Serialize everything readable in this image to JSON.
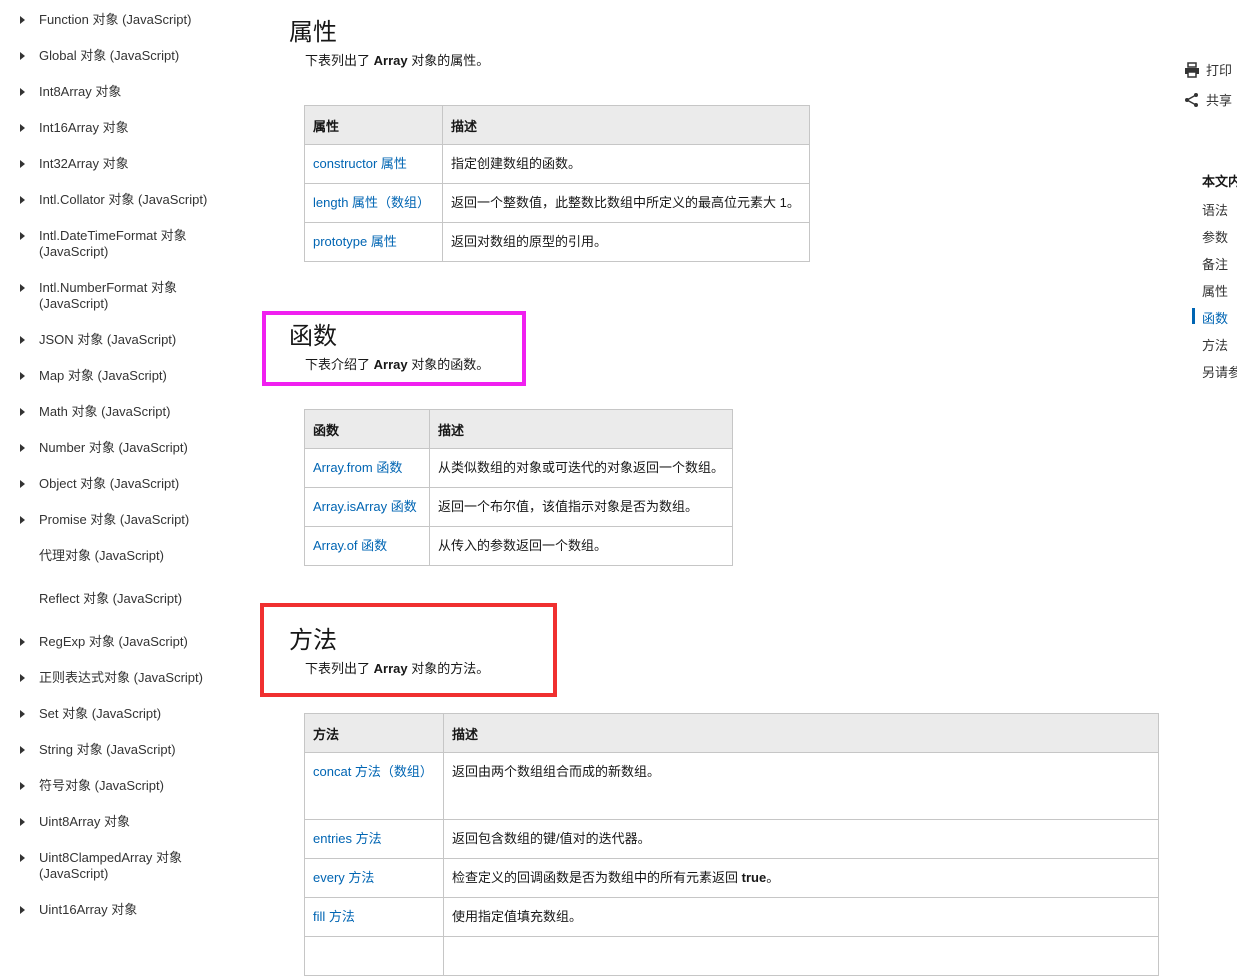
{
  "leftnav": {
    "items": [
      {
        "label": "Function 对象 (JavaScript)",
        "expandable": true
      },
      {
        "label": "Global 对象 (JavaScript)",
        "expandable": true
      },
      {
        "label": "Int8Array 对象",
        "expandable": true
      },
      {
        "label": "Int16Array 对象",
        "expandable": true
      },
      {
        "label": "Int32Array 对象",
        "expandable": true
      },
      {
        "label": "Intl.Collator 对象 (JavaScript)",
        "expandable": true
      },
      {
        "label": "Intl.DateTimeFormat 对象 (JavaScript)",
        "expandable": true
      },
      {
        "label": "Intl.NumberFormat 对象 (JavaScript)",
        "expandable": true
      },
      {
        "label": "JSON 对象 (JavaScript)",
        "expandable": true
      },
      {
        "label": "Map 对象 (JavaScript)",
        "expandable": true
      },
      {
        "label": "Math 对象 (JavaScript)",
        "expandable": true
      },
      {
        "label": "Number 对象 (JavaScript)",
        "expandable": true
      },
      {
        "label": "Object 对象 (JavaScript)",
        "expandable": true
      },
      {
        "label": "Promise 对象 (JavaScript)",
        "expandable": true
      },
      {
        "label": "代理对象 (JavaScript)",
        "expandable": false
      },
      {
        "label": "Reflect 对象 (JavaScript)",
        "expandable": false
      },
      {
        "label": "RegExp 对象 (JavaScript)",
        "expandable": true
      },
      {
        "label": "正则表达式对象 (JavaScript)",
        "expandable": true
      },
      {
        "label": "Set 对象 (JavaScript)",
        "expandable": true
      },
      {
        "label": "String 对象 (JavaScript)",
        "expandable": true
      },
      {
        "label": "符号对象 (JavaScript)",
        "expandable": true
      },
      {
        "label": "Uint8Array 对象",
        "expandable": true
      },
      {
        "label": "Uint8ClampedArray 对象 (JavaScript)",
        "expandable": true
      },
      {
        "label": "Uint16Array 对象",
        "expandable": true
      }
    ]
  },
  "properties": {
    "title": "属性",
    "desc_pre": "下表列出了 ",
    "desc_bold": "Array",
    "desc_post": " 对象的属性。",
    "headers": [
      "属性",
      "描述"
    ],
    "rows": [
      {
        "name": "constructor 属性",
        "desc": "指定创建数组的函数。"
      },
      {
        "name": "length 属性（数组）",
        "desc": "返回一个整数值，此整数比数组中所定义的最高位元素大 1。"
      },
      {
        "name": "prototype 属性",
        "desc": "返回对数组的原型的引用。"
      }
    ]
  },
  "functions": {
    "title": "函数",
    "desc_pre": "下表介绍了 ",
    "desc_bold": "Array",
    "desc_post": " 对象的函数。",
    "headers": [
      "函数",
      "描述"
    ],
    "rows": [
      {
        "name": "Array.from 函数",
        "desc": "从类似数组的对象或可迭代的对象返回一个数组。"
      },
      {
        "name": "Array.isArray 函数",
        "desc": "返回一个布尔值，该值指示对象是否为数组。"
      },
      {
        "name": "Array.of 函数",
        "desc": "从传入的参数返回一个数组。"
      }
    ]
  },
  "methods": {
    "title": "方法",
    "desc_pre": "下表列出了 ",
    "desc_bold": "Array",
    "desc_post": " 对象的方法。",
    "headers": [
      "方法",
      "描述"
    ],
    "rows": [
      {
        "name": "concat 方法（数组）",
        "desc": "返回由两个数组组合而成的新数组。"
      },
      {
        "name": "entries 方法",
        "desc": "返回包含数组的键/值对的迭代器。"
      },
      {
        "name": "every 方法",
        "desc_pre": "检查定义的回调函数是否为数组中的所有元素返回 ",
        "desc_bold": "true",
        "desc_post": "。"
      },
      {
        "name": "fill 方法",
        "desc": "使用指定值填充数组。"
      }
    ]
  },
  "annotations": {
    "functions_box_color": "#f020f0",
    "methods_box_color": "#f03030"
  },
  "rightrail": {
    "print_label": "打印",
    "print_icon": "printer-icon",
    "share_label": "共享",
    "share_icon": "share-icon",
    "toc_title": "本文内",
    "toc_items": [
      "语法",
      "参数",
      "备注",
      "属性",
      "函数",
      "方法",
      "另请参"
    ],
    "toc_active_index": 4
  },
  "colors": {
    "link": "#0065b3",
    "table_header_bg": "#ebebeb",
    "table_border": "#c6c6c6"
  }
}
